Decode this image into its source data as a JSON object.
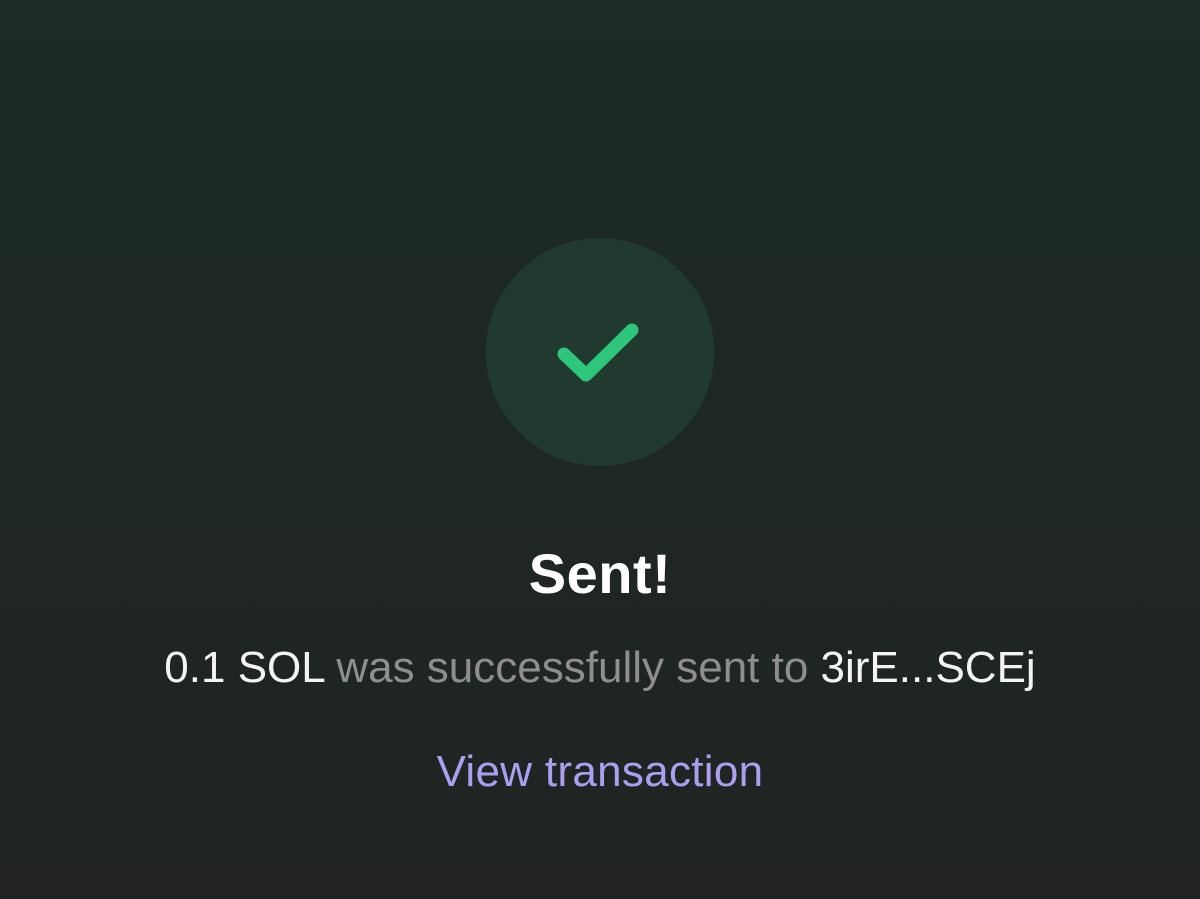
{
  "status": {
    "icon": "check-icon",
    "icon_color": "#2ec67a",
    "circle_color": "#213a2f"
  },
  "title": "Sent!",
  "message": {
    "amount": "0.1 SOL",
    "middle": " was successfully sent to ",
    "recipient": "3irE...SCEj"
  },
  "view_transaction_label": "View transaction",
  "colors": {
    "link": "#ab9ff2",
    "muted_text": "#8e8e8e",
    "primary_text": "#ffffff"
  }
}
